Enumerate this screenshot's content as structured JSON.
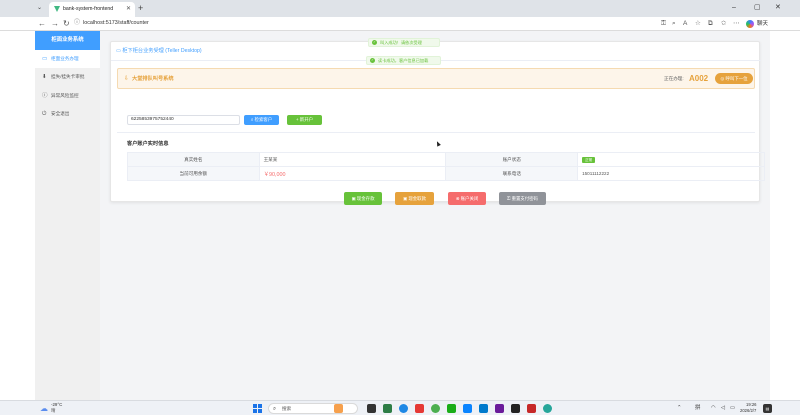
{
  "browser": {
    "tab_title": "bank-system-frontend",
    "url": "localhost:5173/staff/counter",
    "chat_label": "聊天",
    "colors": {
      "accent": "#409eff",
      "favicon": "#41b883"
    }
  },
  "sidebar": {
    "title": "柜面业务系统",
    "items": [
      {
        "label": "柜面业务办理",
        "icon": "monitor-icon",
        "active": true
      },
      {
        "label": "挂失/挂失卡审批",
        "icon": "user-card-icon",
        "active": false
      },
      {
        "label": "异常风险监控",
        "icon": "alert-circle-icon",
        "active": false
      },
      {
        "label": "安全退出",
        "icon": "logout-icon",
        "active": false
      }
    ]
  },
  "card": {
    "header": "柜下柜台业务受理 (Teller Desktop)"
  },
  "queue": {
    "title": "大堂排队叫号系统",
    "current_label": "正在办理:",
    "current_number": "A002",
    "call_next": "呼叫下一位"
  },
  "search": {
    "account_value": "6225853975752440",
    "search_button": "检索客户",
    "open_button": "新开户"
  },
  "info": {
    "title": "客户账户实时信息",
    "real_name_label": "真实姓名",
    "real_name": "王某某",
    "status_label": "账户状态",
    "status": "正常",
    "balance_label": "当前可用余额",
    "balance": "￥90,000",
    "phone_label": "联系电话",
    "phone": "15011112222"
  },
  "actions": {
    "deposit": "现金存款",
    "withdraw": "现金取款",
    "close": "账户关闭",
    "reset_pwd": "重置支付密码"
  },
  "toasts": [
    "叫入成功！请依次受理",
    "读卡成功，客户信息已加载"
  ],
  "taskbar": {
    "temperature": "-29°C",
    "weather": "晴",
    "search_placeholder": "搜索",
    "ime": "拼",
    "time": "19:26",
    "date": "2026/2/7"
  }
}
